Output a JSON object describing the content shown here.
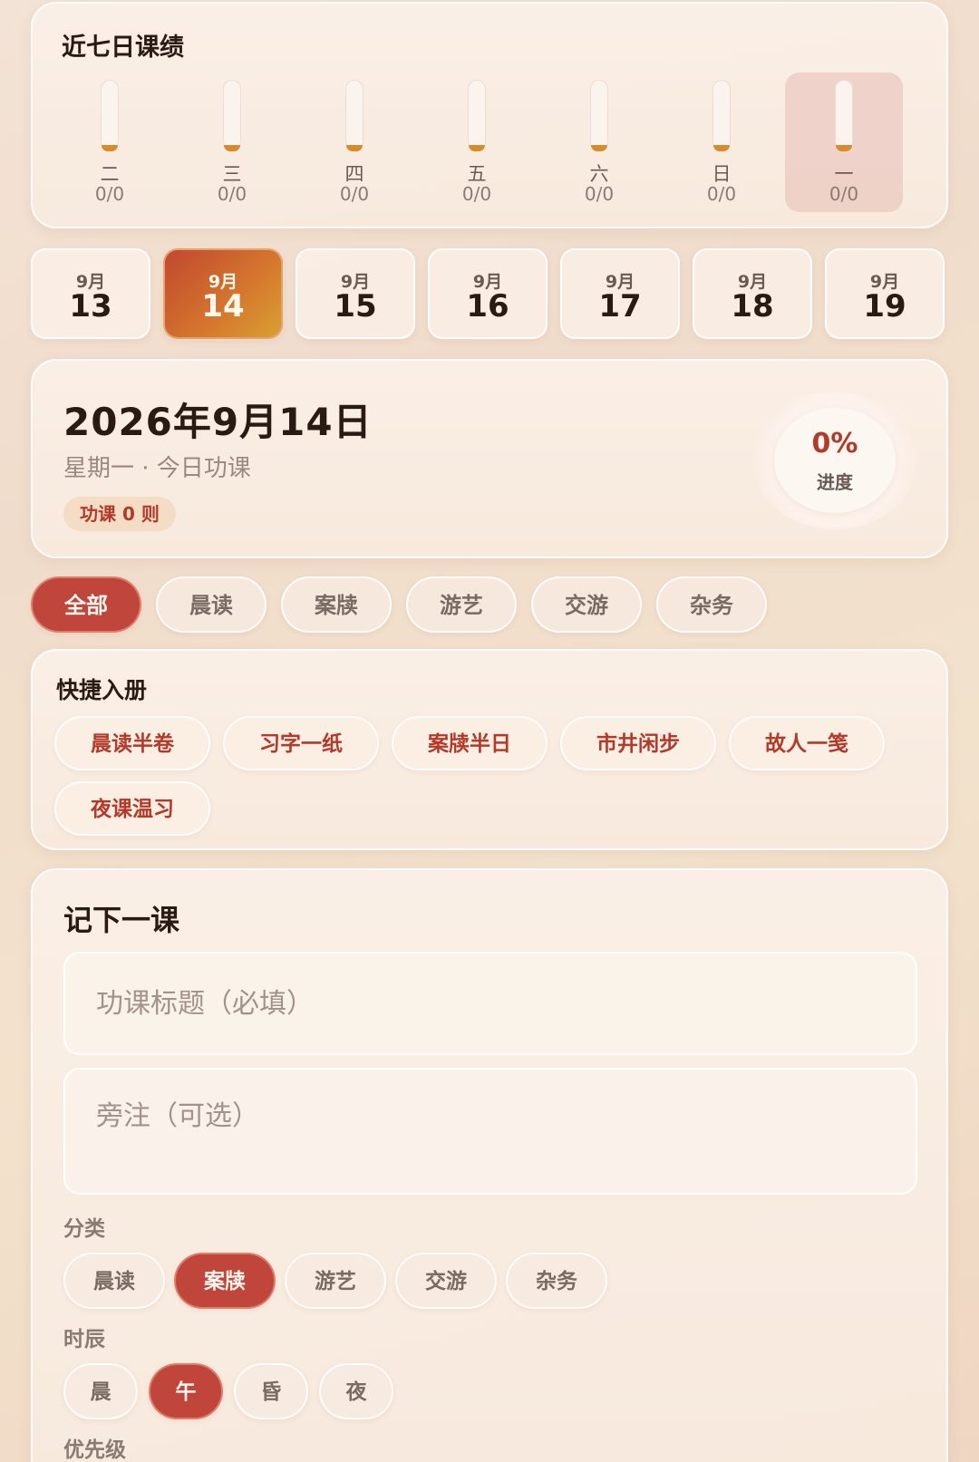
{
  "week": {
    "title": "近七日课绩",
    "days": [
      {
        "label": "二",
        "count": "0/0",
        "fill": 0
      },
      {
        "label": "三",
        "count": "0/0",
        "fill": 0
      },
      {
        "label": "四",
        "count": "0/0",
        "fill": 0
      },
      {
        "label": "五",
        "count": "0/0",
        "fill": 0
      },
      {
        "label": "六",
        "count": "0/0",
        "fill": 0
      },
      {
        "label": "日",
        "count": "0/0",
        "fill": 0
      },
      {
        "label": "一",
        "count": "0/0",
        "fill": 0,
        "active": true
      }
    ]
  },
  "dates": [
    {
      "month": "9月",
      "day": "13"
    },
    {
      "month": "9月",
      "day": "14",
      "selected": true
    },
    {
      "month": "9月",
      "day": "15"
    },
    {
      "month": "9月",
      "day": "16"
    },
    {
      "month": "9月",
      "day": "17"
    },
    {
      "month": "9月",
      "day": "18"
    },
    {
      "month": "9月",
      "day": "19"
    }
  ],
  "today": {
    "date": "2026年9月14日",
    "subtitle": "星期一 · 今日功课",
    "count": "功课 0 则",
    "progress_value": "0%",
    "progress_label": "进度"
  },
  "filters": [
    {
      "label": "全部",
      "active": true
    },
    {
      "label": "晨读"
    },
    {
      "label": "案牍"
    },
    {
      "label": "游艺"
    },
    {
      "label": "交游"
    },
    {
      "label": "杂务"
    }
  ],
  "quick": {
    "title": "快捷入册",
    "items": [
      "晨读半卷",
      "习字一纸",
      "案牍半日",
      "市井闲步",
      "故人一笺",
      "夜课温习"
    ]
  },
  "record": {
    "title": "记下一课",
    "title_placeholder": "功课标题（必填）",
    "note_placeholder": "旁注（可选）",
    "category_label": "分类",
    "categories": [
      {
        "label": "晨读"
      },
      {
        "label": "案牍",
        "active": true
      },
      {
        "label": "游艺"
      },
      {
        "label": "交游"
      },
      {
        "label": "杂务"
      }
    ],
    "time_label": "时辰",
    "times": [
      {
        "label": "晨"
      },
      {
        "label": "午",
        "active": true
      },
      {
        "label": "昏"
      },
      {
        "label": "夜"
      }
    ],
    "priority_label": "优先级"
  },
  "colors": {
    "accent": "#c0453a",
    "accent_text": "#b33a2a",
    "tube_cap": "#d98a2b"
  }
}
